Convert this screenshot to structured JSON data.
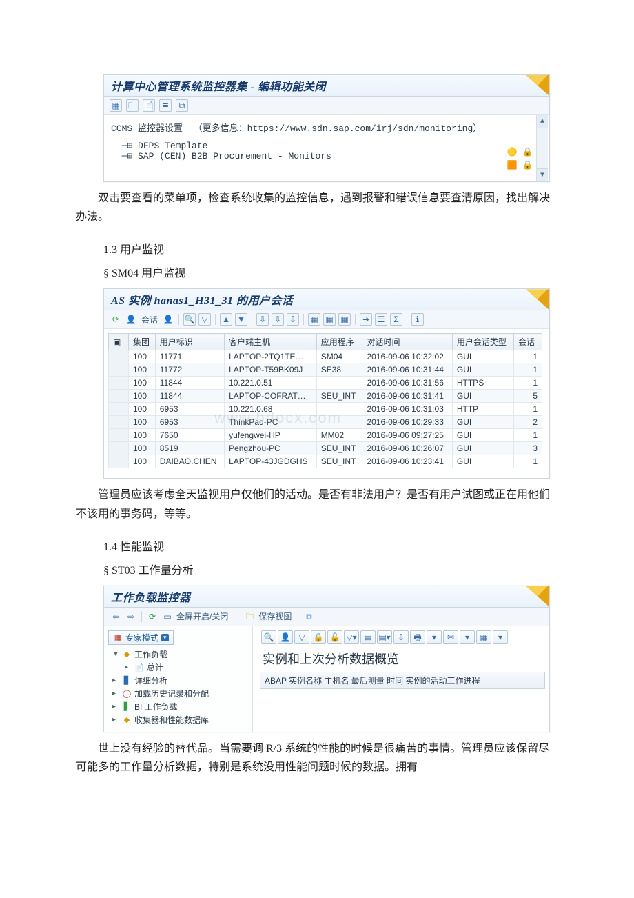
{
  "rz20": {
    "title": "计算中心管理系统监控器集 - 编辑功能关闭",
    "toolbar_icons": [
      "grid-icon",
      "tree-icon",
      "doc-icon",
      "list-icon",
      "copy-icon"
    ],
    "info_line": "CCMS 监控器设置  （更多信息：https://www.sdn.sap.com/irj/sdn/monitoring）",
    "tree_items": [
      "DFPS Template",
      "SAP (CEN) B2B Procurement - Monitors"
    ]
  },
  "para_after_rz20_1": "双击要查看的菜单项，检查系统收集的监控信息，遇到报警和错误信息要查清原因，找出解决办法。",
  "sect13_num": "1.3  用户监视",
  "sect13_bullet": "§      SM04 用户监视",
  "sm04": {
    "title": "AS 实例 hanas1_H31_31 的用户会话",
    "toolbar_text": "会话",
    "columns": [
      "集团",
      "用户标识",
      "客户端主机",
      "应用程序",
      "对话时间",
      "用户会话类型",
      "会话"
    ],
    "rows": [
      {
        "client": "100",
        "user": "11771",
        "host": "LAPTOP-2TQ1TE…",
        "app": "SM04",
        "time": "2016-09-06 10:32:02",
        "type": "GUI",
        "n": "1"
      },
      {
        "client": "100",
        "user": "11772",
        "host": "LAPTOP-T59BK09J",
        "app": "SE38",
        "time": "2016-09-06 10:31:44",
        "type": "GUI",
        "n": "1"
      },
      {
        "client": "100",
        "user": "11844",
        "host": "10.221.0.51",
        "app": "",
        "time": "2016-09-06 10:31:56",
        "type": "HTTPS",
        "n": "1"
      },
      {
        "client": "100",
        "user": "11844",
        "host": "LAPTOP-COFRAT…",
        "app": "SEU_INT",
        "time": "2016-09-06 10:31:41",
        "type": "GUI",
        "n": "5"
      },
      {
        "client": "100",
        "user": "6953",
        "host": "10.221.0.68",
        "app": "",
        "time": "2016-09-06 10:31:03",
        "type": "HTTP",
        "n": "1"
      },
      {
        "client": "100",
        "user": "6953",
        "host": "ThinkPad-PC",
        "app": "",
        "time": "2016-09-06 10:29:33",
        "type": "GUI",
        "n": "2"
      },
      {
        "client": "100",
        "user": "7650",
        "host": "yufengwei-HP",
        "app": "MM02",
        "time": "2016-09-06 09:27:25",
        "type": "GUI",
        "n": "1"
      },
      {
        "client": "100",
        "user": "8519",
        "host": "Pengzhou-PC",
        "app": "SEU_INT",
        "time": "2016-09-06 10:26:07",
        "type": "GUI",
        "n": "3"
      },
      {
        "client": "100",
        "user": "DAIBAO.CHEN",
        "host": "LAPTOP-43JGDGHS",
        "app": "SEU_INT",
        "time": "2016-09-06 10:23:41",
        "type": "GUI",
        "n": "1"
      }
    ]
  },
  "para_after_sm04": "管理员应该考虑全天监视用户仅他们的活动。是否有非法用户？是否有用户试图或正在用他们不该用的事务码，等等。",
  "sect14_num": "1.4  性能监视",
  "sect14_bullet": "§      ST03 工作量分析",
  "st03": {
    "title": "工作负载监控器",
    "toolbar": {
      "fullscreen": "全屏开启/关闭",
      "saveview": "保存视图"
    },
    "nav": {
      "mode": "专家模式",
      "items": [
        {
          "label": "工作负载",
          "icon": "yellow",
          "expanded": true
        },
        {
          "label": "总计",
          "icon": "doc",
          "indent": 1
        },
        {
          "label": "详细分析",
          "icon": "blue"
        },
        {
          "label": "加载历史记录和分配",
          "icon": "red"
        },
        {
          "label": "BI 工作负载",
          "icon": "green"
        },
        {
          "label": "收集器和性能数据库",
          "icon": "yellow"
        }
      ]
    },
    "main_heading": "实例和上次分析数据概览",
    "main_columns": "ABAP 实例名称 主机名   最后测量   时间 实例的活动工作进程"
  },
  "para_after_st03": "世上没有经验的替代品。当需要调 R/3 系统的性能的时候是很痛苦的事情。管理员应该保留尽可能多的工作量分析数据，特别是系统没用性能问题时候的数据。拥有",
  "watermark": "www.bdocx.com"
}
